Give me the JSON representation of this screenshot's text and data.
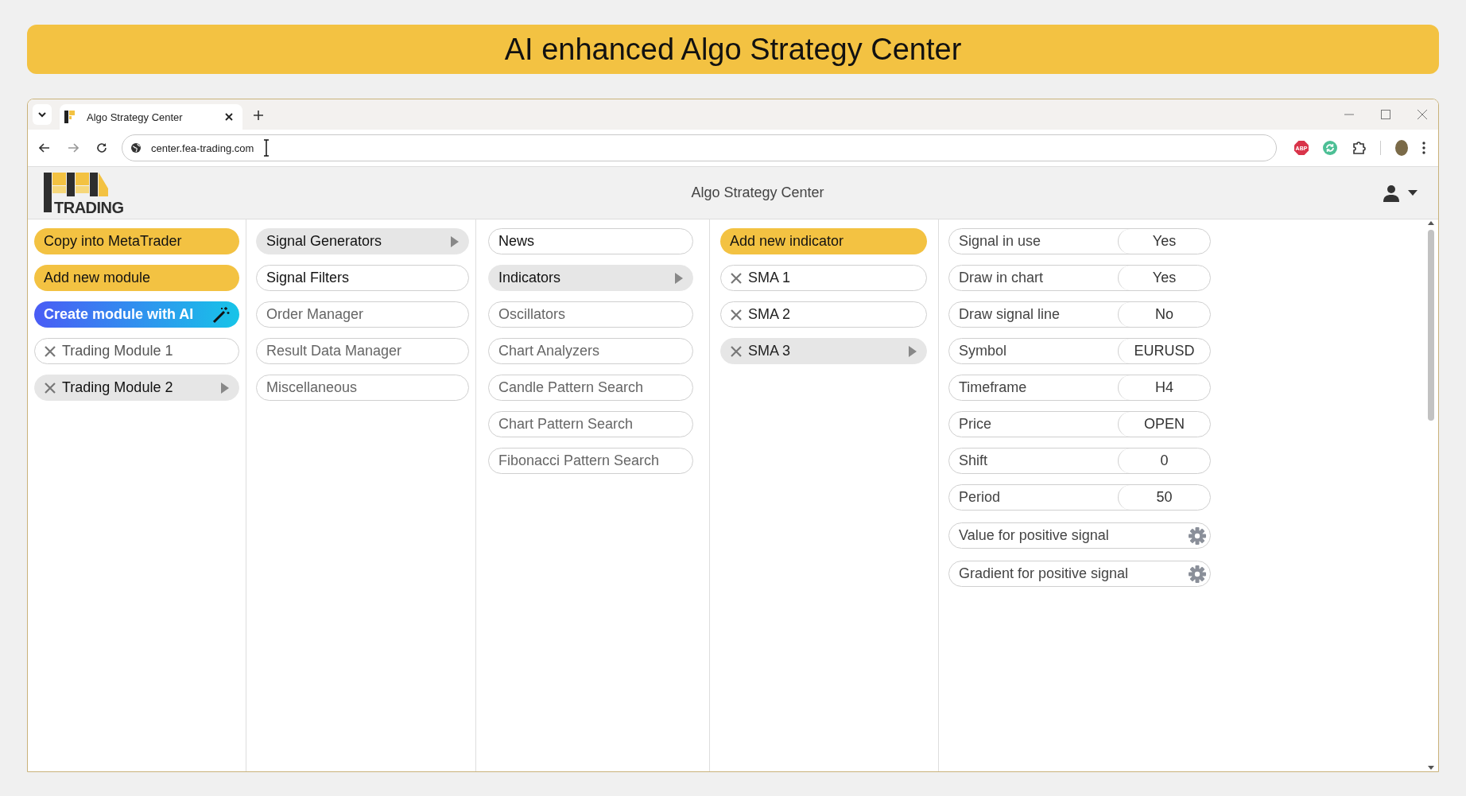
{
  "banner": {
    "title": "AI enhanced Algo Strategy Center"
  },
  "browser": {
    "tab": {
      "title": "Algo Strategy Center"
    },
    "url": "center.fea-trading.com",
    "extensions": [
      {
        "kind": "abp",
        "label": "ABP"
      },
      {
        "kind": "sync"
      },
      {
        "kind": "puzzle"
      }
    ]
  },
  "app_header": {
    "logo_text": "TRADING",
    "title": "Algo Strategy Center"
  },
  "columns": [
    {
      "items": [
        {
          "kind": "action",
          "label": "Copy into MetaTrader"
        },
        {
          "kind": "action",
          "label": "Add new module"
        },
        {
          "kind": "ai",
          "label": "Create module with AI"
        },
        {
          "kind": "removable",
          "label": "Trading Module 1",
          "selected": false
        },
        {
          "kind": "removable",
          "label": "Trading Module 2",
          "selected": true
        }
      ]
    },
    {
      "items": [
        {
          "kind": "menu",
          "label": "Signal Generators",
          "selected": true,
          "disabled": false
        },
        {
          "kind": "menu",
          "label": "Signal Filters",
          "selected": false,
          "disabled": false
        },
        {
          "kind": "menu",
          "label": "Order Manager",
          "selected": false,
          "disabled": true
        },
        {
          "kind": "menu",
          "label": "Result Data Manager",
          "selected": false,
          "disabled": true
        },
        {
          "kind": "menu",
          "label": "Miscellaneous",
          "selected": false,
          "disabled": true
        }
      ]
    },
    {
      "items": [
        {
          "kind": "menu",
          "label": "News",
          "selected": false,
          "disabled": false
        },
        {
          "kind": "menu",
          "label": "Indicators",
          "selected": true,
          "disabled": false
        },
        {
          "kind": "menu",
          "label": "Oscillators",
          "selected": false,
          "disabled": true
        },
        {
          "kind": "menu",
          "label": "Chart Analyzers",
          "selected": false,
          "disabled": true
        },
        {
          "kind": "menu",
          "label": "Candle Pattern Search",
          "selected": false,
          "disabled": true
        },
        {
          "kind": "menu",
          "label": "Chart Pattern Search",
          "selected": false,
          "disabled": true
        },
        {
          "kind": "menu",
          "label": "Fibonacci Pattern Search",
          "selected": false,
          "disabled": true
        }
      ]
    },
    {
      "items": [
        {
          "kind": "action",
          "label": "Add new indicator"
        },
        {
          "kind": "removable",
          "label": "SMA 1",
          "selected": false
        },
        {
          "kind": "removable",
          "label": "SMA 2",
          "selected": false
        },
        {
          "kind": "removable",
          "label": "SMA 3",
          "selected": true
        }
      ]
    }
  ],
  "settings": [
    {
      "kind": "value",
      "label": "Signal in use",
      "value": "Yes"
    },
    {
      "kind": "value",
      "label": "Draw in chart",
      "value": "Yes"
    },
    {
      "kind": "value",
      "label": "Draw signal line",
      "value": "No"
    },
    {
      "kind": "value",
      "label": "Symbol",
      "value": "EURUSD"
    },
    {
      "kind": "value",
      "label": "Timeframe",
      "value": "H4"
    },
    {
      "kind": "value",
      "label": "Price",
      "value": "OPEN"
    },
    {
      "kind": "value",
      "label": "Shift",
      "value": "0"
    },
    {
      "kind": "value",
      "label": "Period",
      "value": "50"
    },
    {
      "kind": "gear",
      "label": "Value for positive signal"
    },
    {
      "kind": "gear",
      "label": "Gradient for positive signal"
    }
  ]
}
